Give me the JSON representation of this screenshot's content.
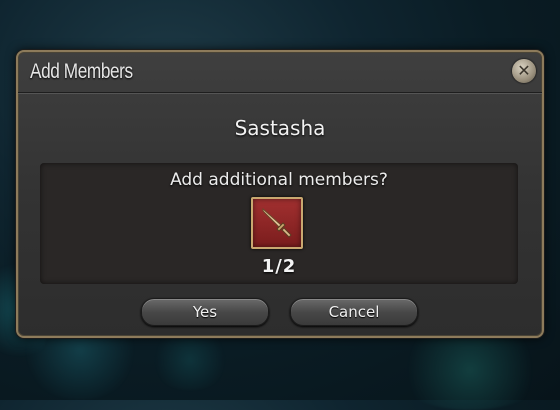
{
  "dialog": {
    "title": "Add Members",
    "destination": "Sastasha",
    "question": "Add additional members?",
    "party_count": "1/2",
    "job_icon": "sword-icon",
    "close_icon": "close-icon",
    "buttons": {
      "yes": "Yes",
      "cancel": "Cancel"
    }
  },
  "colors": {
    "frame_border": "#8d7b5b",
    "window_bg": "#333333",
    "panel_bg": "#2a2726",
    "job_icon_bg": "#8b2424",
    "text": "#ececec"
  }
}
